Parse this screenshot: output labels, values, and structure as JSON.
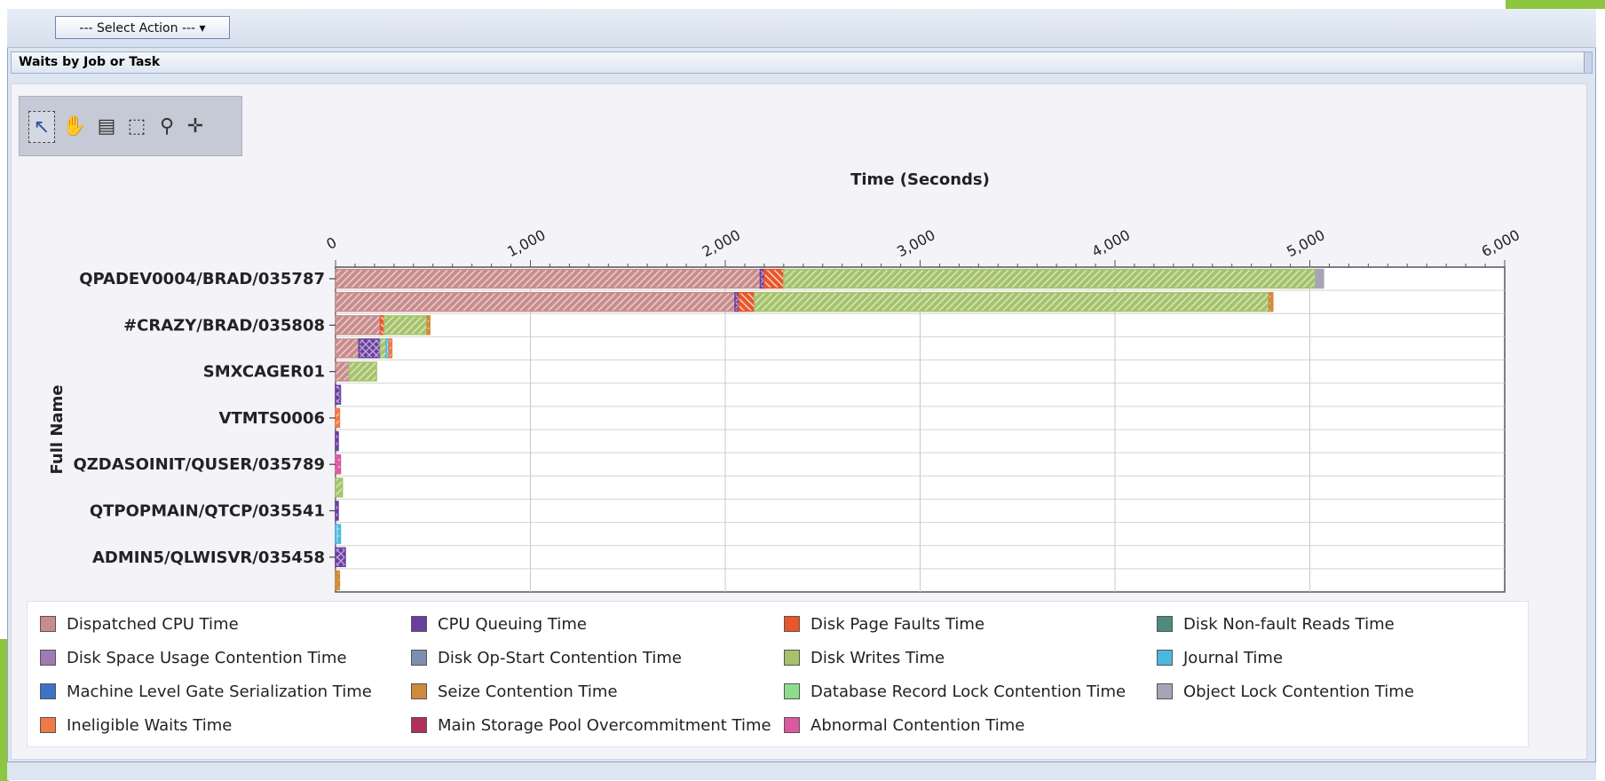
{
  "toolbar": {
    "select_action_label": "--- Select Action --- ▾"
  },
  "section": {
    "title": "Waits by Job or Task"
  },
  "chart_tools": [
    {
      "name": "select-arrow-icon",
      "glyph": "↖",
      "selected": true
    },
    {
      "name": "pan-hand-icon",
      "glyph": "✋",
      "selected": false
    },
    {
      "name": "tooltip-icon",
      "glyph": "▤",
      "selected": false
    },
    {
      "name": "zoom-box-icon",
      "glyph": "⬚",
      "selected": false
    },
    {
      "name": "zoom-out-icon",
      "glyph": "⚲",
      "selected": false
    },
    {
      "name": "crosshair-icon",
      "glyph": "✛",
      "selected": false
    }
  ],
  "chart_data": {
    "type": "bar",
    "orientation": "horizontal",
    "stacked": true,
    "title": "Time (Seconds)",
    "xlabel": "Time (Seconds)",
    "ylabel": "Full Name",
    "xlim": [
      0,
      6000
    ],
    "x_ticks": [
      "0",
      "1,000",
      "2,000",
      "3,000",
      "4,000",
      "5,000",
      "6,000"
    ],
    "x_tick_values": [
      0,
      1000,
      2000,
      3000,
      4000,
      5000,
      6000
    ],
    "grid": true,
    "legend_position": "bottom",
    "y_tick_labels": [
      {
        "label": "QPADEV0004/BRAD/035787",
        "row": 0
      },
      {
        "label": "#CRAZY/BRAD/035808",
        "row": 2
      },
      {
        "label": "SMXCAGER01",
        "row": 4
      },
      {
        "label": "VTMTS0006",
        "row": 6
      },
      {
        "label": "QZDASOINIT/QUSER/035789",
        "row": 8
      },
      {
        "label": "QTPOPMAIN/QTCP/035541",
        "row": 10
      },
      {
        "label": "ADMIN5/QLWISVR/035458",
        "row": 12
      }
    ],
    "series": [
      {
        "name": "Dispatched CPU Time",
        "color": "#c98b8b",
        "pattern": "diag"
      },
      {
        "name": "CPU Queuing Time",
        "color": "#6a3fa0",
        "pattern": "cross"
      },
      {
        "name": "Disk Page Faults Time",
        "color": "#e9562a",
        "pattern": "stripe"
      },
      {
        "name": "Disk Non-fault Reads Time",
        "color": "#4f8a7e",
        "pattern": "grid"
      },
      {
        "name": "Disk Space Usage Contention Time",
        "color": "#a07ab0",
        "pattern": "grid"
      },
      {
        "name": "Disk Op-Start Contention Time",
        "color": "#7d8fb0",
        "pattern": "dots"
      },
      {
        "name": "Disk Writes Time",
        "color": "#a6c36b",
        "pattern": "diag"
      },
      {
        "name": "Journal Time",
        "color": "#4bb8e0",
        "pattern": "grid"
      },
      {
        "name": "Machine Level Gate Serialization Time",
        "color": "#3c73c4",
        "pattern": "stripe"
      },
      {
        "name": "Seize Contention Time",
        "color": "#d08a3c",
        "pattern": "dots"
      },
      {
        "name": "Database Record Lock Contention Time",
        "color": "#8fdc8f",
        "pattern": "none"
      },
      {
        "name": "Object Lock Contention Time",
        "color": "#a8a4b8",
        "pattern": "none"
      },
      {
        "name": "Ineligible Waits Time",
        "color": "#ef7a45",
        "pattern": "diag"
      },
      {
        "name": "Main Storage Pool Overcommitment Time",
        "color": "#b0305a",
        "pattern": "grid"
      },
      {
        "name": "Abnormal Contention Time",
        "color": "#d95aa0",
        "pattern": "dots"
      }
    ],
    "bars": [
      {
        "row": 0,
        "segments": [
          {
            "series": "Dispatched CPU Time",
            "value": 2180
          },
          {
            "series": "CPU Queuing Time",
            "value": 20
          },
          {
            "series": "Disk Page Faults Time",
            "value": 100
          },
          {
            "series": "Disk Writes Time",
            "value": 2730
          },
          {
            "series": "Object Lock Contention Time",
            "value": 40
          }
        ]
      },
      {
        "row": 1,
        "segments": [
          {
            "series": "Dispatched CPU Time",
            "value": 2050
          },
          {
            "series": "CPU Queuing Time",
            "value": 20
          },
          {
            "series": "Disk Page Faults Time",
            "value": 80
          },
          {
            "series": "Disk Writes Time",
            "value": 2640
          },
          {
            "series": "Seize Contention Time",
            "value": 20
          }
        ]
      },
      {
        "row": 2,
        "segments": [
          {
            "series": "Dispatched CPU Time",
            "value": 230
          },
          {
            "series": "Disk Page Faults Time",
            "value": 20
          },
          {
            "series": "Disk Writes Time",
            "value": 220
          },
          {
            "series": "Seize Contention Time",
            "value": 10
          }
        ]
      },
      {
        "row": 3,
        "segments": [
          {
            "series": "Dispatched CPU Time",
            "value": 120
          },
          {
            "series": "CPU Queuing Time",
            "value": 110
          },
          {
            "series": "Disk Writes Time",
            "value": 30
          },
          {
            "series": "Journal Time",
            "value": 15
          },
          {
            "series": "Ineligible Waits Time",
            "value": 10
          }
        ]
      },
      {
        "row": 4,
        "segments": [
          {
            "series": "Dispatched CPU Time",
            "value": 70
          },
          {
            "series": "Disk Writes Time",
            "value": 140
          }
        ]
      },
      {
        "row": 5,
        "segments": [
          {
            "series": "CPU Queuing Time",
            "value": 25
          }
        ]
      },
      {
        "row": 6,
        "segments": [
          {
            "series": "Ineligible Waits Time",
            "value": 20
          }
        ]
      },
      {
        "row": 7,
        "segments": [
          {
            "series": "CPU Queuing Time",
            "value": 12
          }
        ]
      },
      {
        "row": 8,
        "segments": [
          {
            "series": "Abnormal Contention Time",
            "value": 25
          }
        ]
      },
      {
        "row": 9,
        "segments": [
          {
            "series": "Disk Writes Time",
            "value": 35
          }
        ]
      },
      {
        "row": 10,
        "segments": [
          {
            "series": "CPU Queuing Time",
            "value": 12
          }
        ]
      },
      {
        "row": 11,
        "segments": [
          {
            "series": "Journal Time",
            "value": 25
          }
        ]
      },
      {
        "row": 12,
        "segments": [
          {
            "series": "CPU Queuing Time",
            "value": 50
          }
        ]
      },
      {
        "row": 13,
        "segments": [
          {
            "series": "Seize Contention Time",
            "value": 20
          }
        ]
      }
    ],
    "row_count": 14
  }
}
